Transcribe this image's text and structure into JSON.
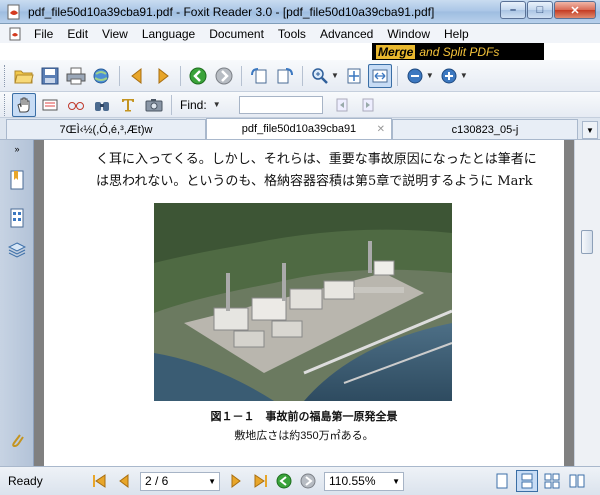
{
  "window": {
    "title": "pdf_file50d10a39cba91.pdf - Foxit Reader 3.0 - [pdf_file50d10a39cba91.pdf]",
    "controls": {
      "minimize": "–",
      "maximize": "□",
      "close": "✕"
    }
  },
  "menu": {
    "items": [
      "File",
      "Edit",
      "View",
      "Language",
      "Document",
      "Tools",
      "Advanced",
      "Window",
      "Help"
    ],
    "ad": {
      "highlight": "Merge",
      "text": "and Split PDFs"
    }
  },
  "toolbar2": {
    "find_label": "Find:",
    "find_value": ""
  },
  "tabs": [
    {
      "label": "7ŒÌ‹½(,Ó,é,³,Æt)w",
      "active": false
    },
    {
      "label": "pdf_file50d10a39cba91",
      "active": true
    },
    {
      "label": "c130823_05-j",
      "active": false
    }
  ],
  "document": {
    "line1": "く耳に入ってくる。しかし、それらは、重要な事故原因になったとは筆者に",
    "line2": "は思われない。というのも、格納容器容積は第5章で説明するように Mark",
    "figure_title": "図１－１　事故前の福島第一原発全景",
    "figure_caption": "敷地広さは約350万㎡ある。"
  },
  "status": {
    "ready": "Ready",
    "page": "2 / 6",
    "zoom": "110.55%"
  },
  "colors": {
    "nav_arrow": "#e8a62a",
    "go_green": "#3aa33a",
    "ad_orange": "#e9b82e"
  }
}
